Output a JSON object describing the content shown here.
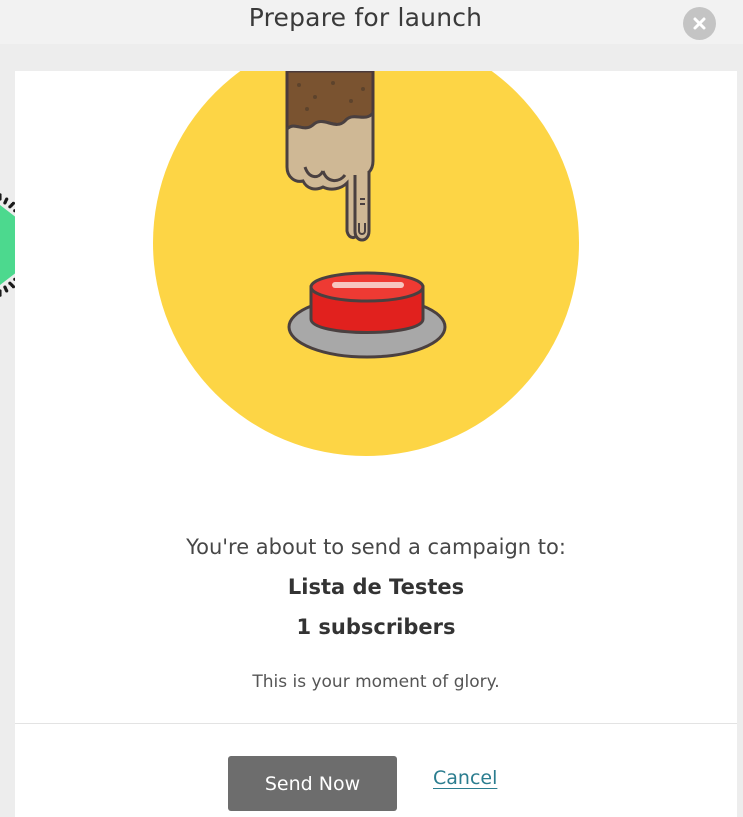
{
  "modal": {
    "title": "Prepare for launch",
    "close_icon": "close-icon"
  },
  "illustration": {
    "icon": "finger-pressing-button-illustration",
    "circle_color": "#fdd545",
    "button_color": "#e1211e"
  },
  "campaign": {
    "intro": "You're about to send a campaign to:",
    "list_name": "Lista de Testes",
    "subscribers": "1 subscribers",
    "tagline": "This is your moment of glory."
  },
  "actions": {
    "send_label": "Send Now",
    "cancel_label": "Cancel"
  },
  "colors": {
    "accent": "#2b7d8f",
    "send_button": "#6d6d6d",
    "decor_fill": "#4cd98e"
  }
}
